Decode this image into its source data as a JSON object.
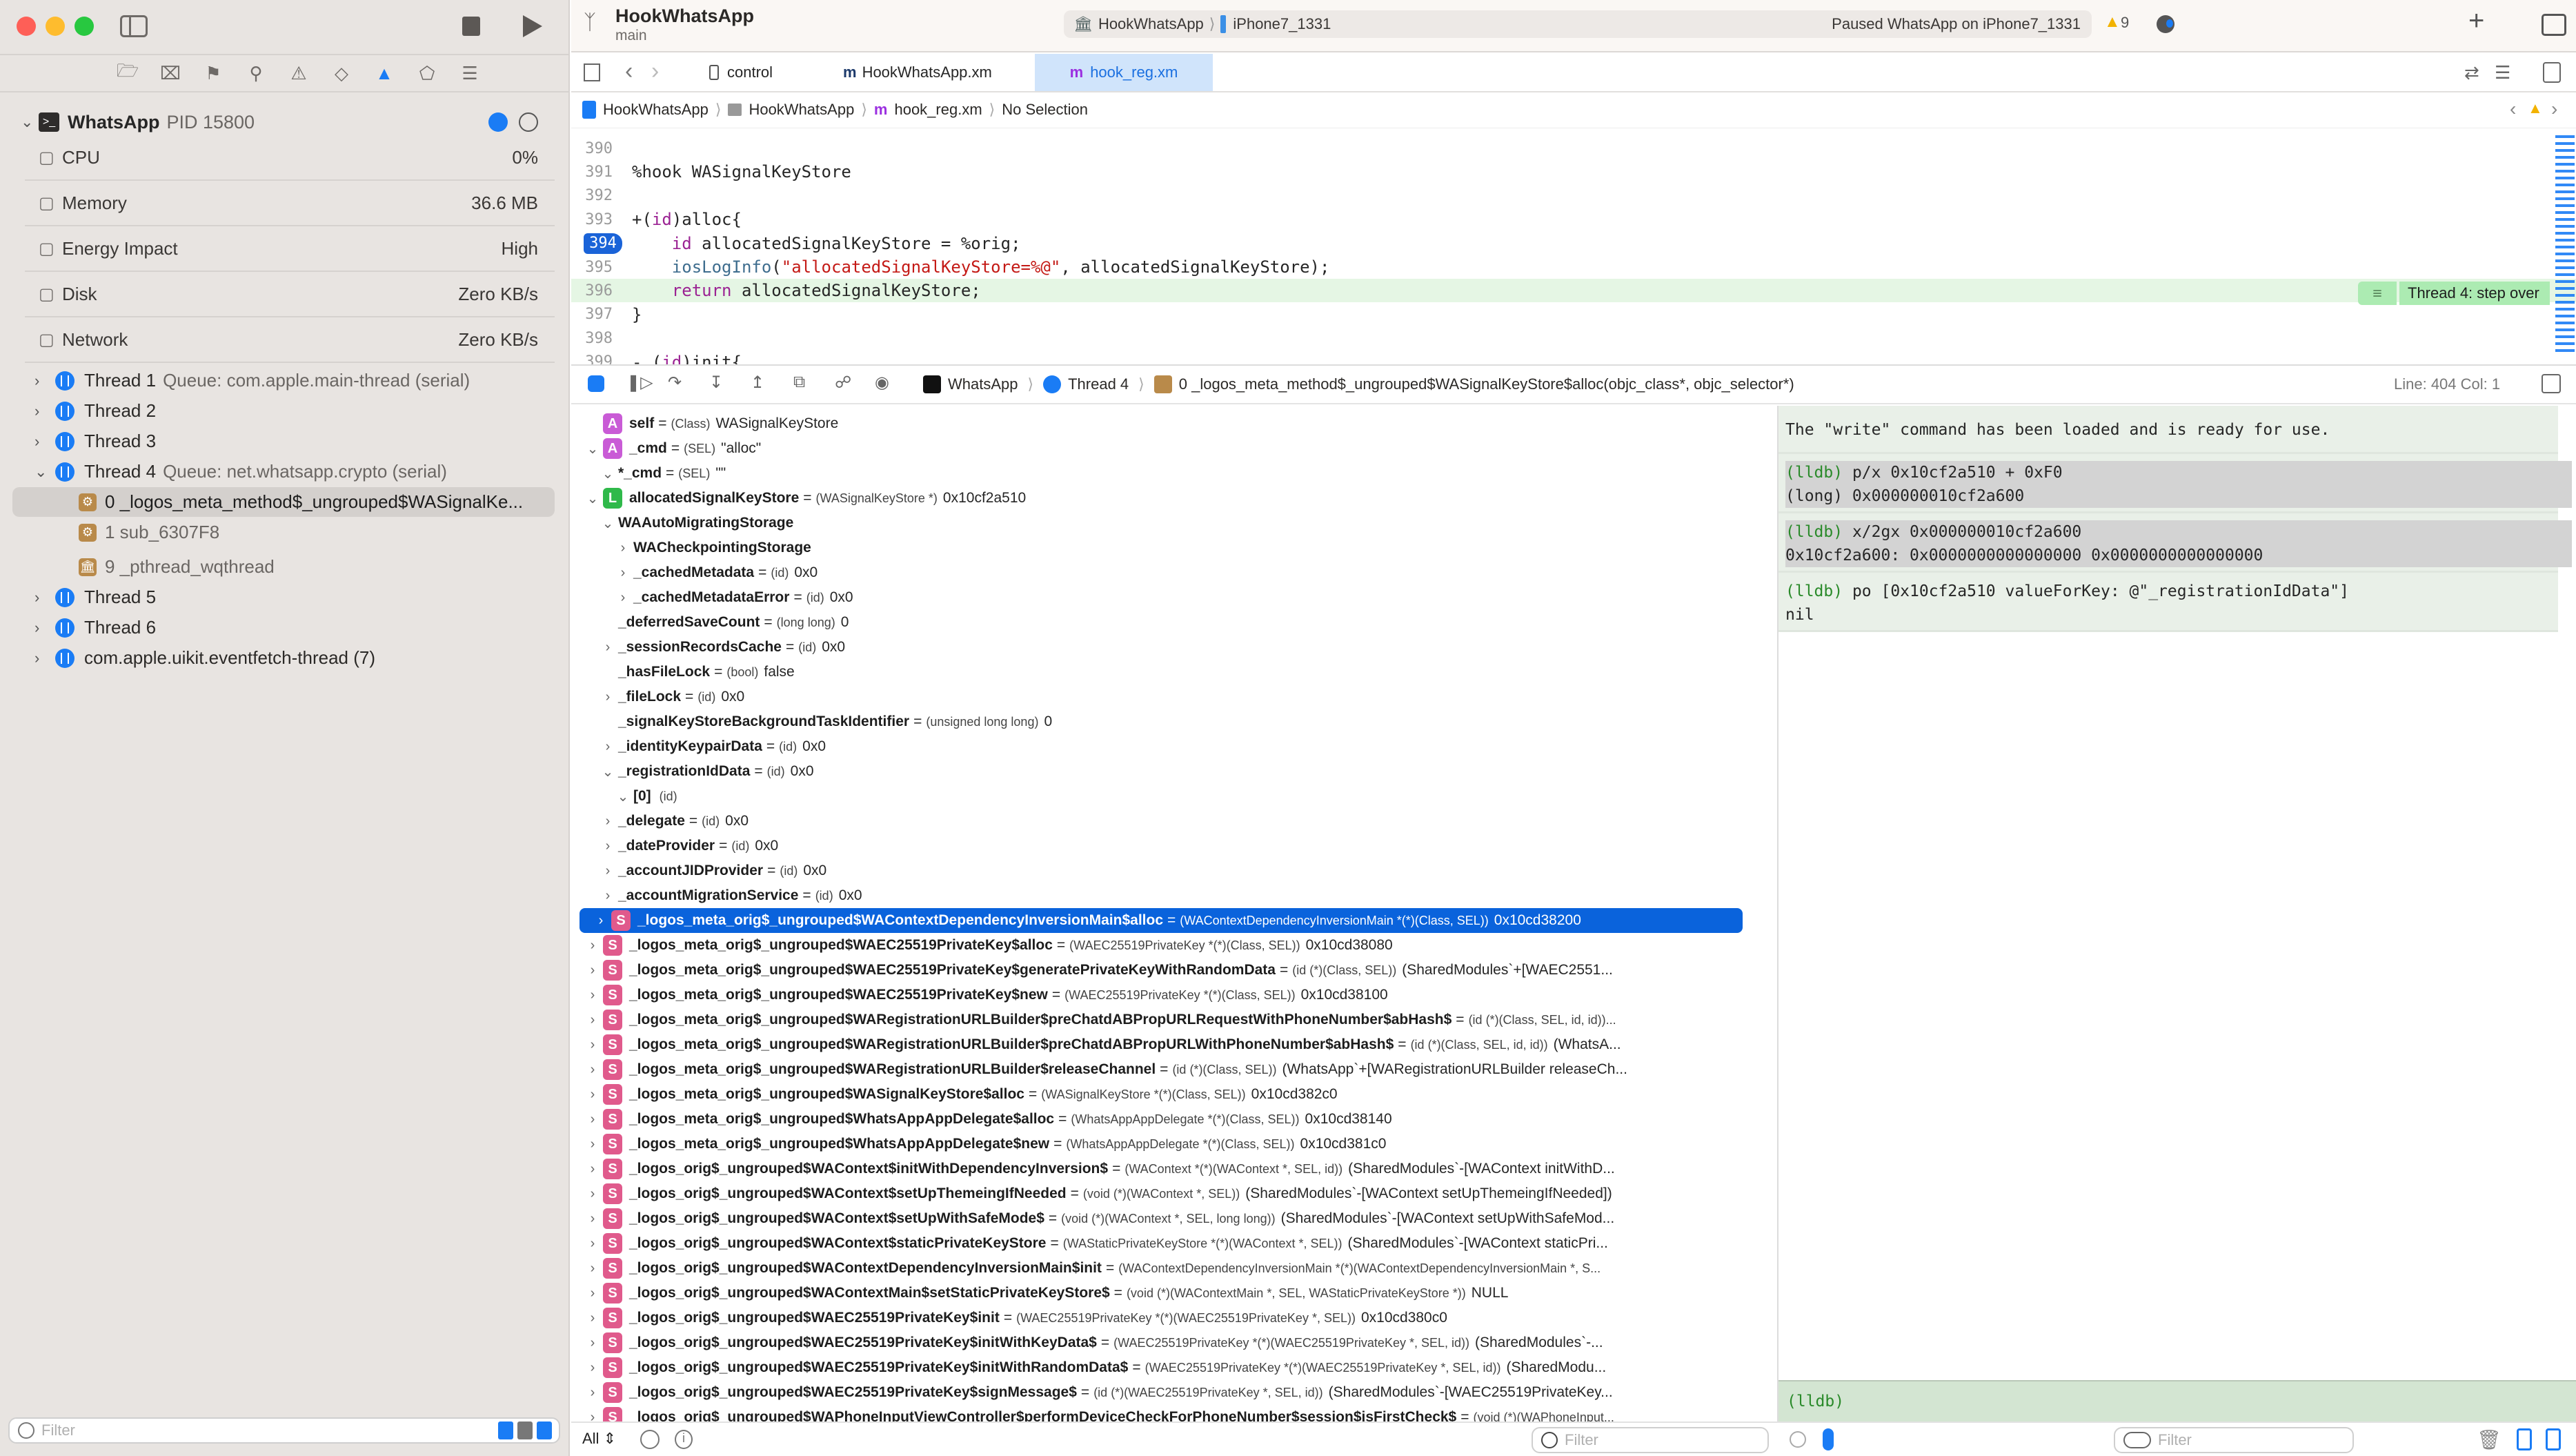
{
  "window": {
    "project": "HookWhatsApp",
    "branch": "main",
    "scheme": "HookWhatsApp",
    "device": "iPhone7_1331",
    "status": "Paused WhatsApp on iPhone7_1331",
    "warning_count": "9"
  },
  "navigator": {
    "process": {
      "name": "WhatsApp",
      "pid": "PID 15800"
    },
    "resources": [
      {
        "icon": "cpu-icon",
        "label": "CPU",
        "value": "0%"
      },
      {
        "icon": "memory-icon",
        "label": "Memory",
        "value": "36.6 MB"
      },
      {
        "icon": "energy-icon",
        "label": "Energy Impact",
        "value": "High"
      },
      {
        "icon": "disk-icon",
        "label": "Disk",
        "value": "Zero KB/s"
      },
      {
        "icon": "network-icon",
        "label": "Network",
        "value": "Zero KB/s"
      }
    ],
    "threads": [
      {
        "name": "Thread 1",
        "queue": "Queue: com.apple.main-thread (serial)",
        "expanded": false
      },
      {
        "name": "Thread 2",
        "queue": "",
        "expanded": false
      },
      {
        "name": "Thread 3",
        "queue": "",
        "expanded": false
      },
      {
        "name": "Thread 4",
        "queue": "Queue: net.whatsapp.crypto (serial)",
        "expanded": true
      },
      {
        "name": "Thread 5",
        "queue": "",
        "expanded": false
      },
      {
        "name": "Thread 6",
        "queue": "",
        "expanded": false
      },
      {
        "name": "com.apple.uikit.eventfetch-thread (7)",
        "queue": "",
        "expanded": false
      }
    ],
    "frames": [
      {
        "label": "0 _logos_meta_method$_ungrouped$WASignalKe...",
        "selected": true
      },
      {
        "label": "1 sub_6307F8",
        "selected": false
      },
      {
        "label": "9 _pthread_wqthread",
        "selected": false
      }
    ],
    "filter_placeholder": "Filter"
  },
  "tabs": [
    {
      "label": "control",
      "active": false
    },
    {
      "label": "HookWhatsApp.xm",
      "active": false
    },
    {
      "label": "hook_reg.xm",
      "active": true
    }
  ],
  "breadcrumb": [
    "HookWhatsApp",
    "HookWhatsApp",
    "hook_reg.xm",
    "No Selection"
  ],
  "code": {
    "lines": [
      {
        "n": "390",
        "text": ""
      },
      {
        "n": "391",
        "text": "%hook WASignalKeyStore"
      },
      {
        "n": "392",
        "text": ""
      },
      {
        "n": "393",
        "text": "+(id)alloc{"
      },
      {
        "n": "394",
        "text": "    id allocatedSignalKeyStore = %orig;"
      },
      {
        "n": "395",
        "text": "    iosLogInfo(\"allocatedSignalKeyStore=%@\", allocatedSignalKeyStore);"
      },
      {
        "n": "396",
        "text": "    return allocatedSignalKeyStore;"
      },
      {
        "n": "397",
        "text": "}"
      },
      {
        "n": "398",
        "text": ""
      },
      {
        "n": "399",
        "text": "- (id)init{"
      }
    ],
    "breakpoint_line": "394",
    "current_line": "396",
    "annotation": "Thread 4: step over"
  },
  "debugbar": {
    "process": "WhatsApp",
    "thread": "Thread 4",
    "frame": "0 _logos_meta_method$_ungrouped$WASignalKeyStore$alloc(objc_class*, objc_selector*)",
    "position": "Line: 404  Col: 1"
  },
  "variables": [
    {
      "indent": 0,
      "chev": "",
      "badge": "A",
      "name": "self",
      "type": "(Class)",
      "value": "WASignalKeyStore"
    },
    {
      "indent": 0,
      "chev": "v",
      "badge": "A",
      "name": "_cmd",
      "type": "(SEL)",
      "value": "\"alloc\""
    },
    {
      "indent": 1,
      "chev": "v",
      "badge": "",
      "name": "*_cmd",
      "type": "(SEL)",
      "value": "\"\""
    },
    {
      "indent": 0,
      "chev": "v",
      "badge": "L",
      "name": "allocatedSignalKeyStore",
      "type": "(WASignalKeyStore *)",
      "value": "0x10cf2a510"
    },
    {
      "indent": 1,
      "chev": "v",
      "badge": "",
      "name": "WAAutoMigratingStorage",
      "type": "",
      "value": ""
    },
    {
      "indent": 2,
      "chev": ">",
      "badge": "",
      "name": "WACheckpointingStorage",
      "type": "",
      "value": ""
    },
    {
      "indent": 2,
      "chev": ">",
      "badge": "",
      "name": "_cachedMetadata",
      "type": "(id)",
      "value": "0x0"
    },
    {
      "indent": 2,
      "chev": ">",
      "badge": "",
      "name": "_cachedMetadataError",
      "type": "(id)",
      "value": "0x0"
    },
    {
      "indent": 1,
      "chev": "",
      "badge": "",
      "name": "_deferredSaveCount",
      "type": "(long long)",
      "value": "0"
    },
    {
      "indent": 1,
      "chev": ">",
      "badge": "",
      "name": "_sessionRecordsCache",
      "type": "(id)",
      "value": "0x0"
    },
    {
      "indent": 1,
      "chev": "",
      "badge": "",
      "name": "_hasFileLock",
      "type": "(bool)",
      "value": "false"
    },
    {
      "indent": 1,
      "chev": ">",
      "badge": "",
      "name": "_fileLock",
      "type": "(id)",
      "value": "0x0"
    },
    {
      "indent": 1,
      "chev": "",
      "badge": "",
      "name": "_signalKeyStoreBackgroundTaskIdentifier",
      "type": "(unsigned long long)",
      "value": "0"
    },
    {
      "indent": 1,
      "chev": ">",
      "badge": "",
      "name": "_identityKeypairData",
      "type": "(id)",
      "value": "0x0"
    },
    {
      "indent": 1,
      "chev": "v",
      "badge": "",
      "name": "_registrationIdData",
      "type": "(id)",
      "value": "0x0"
    },
    {
      "indent": 2,
      "chev": "v",
      "badge": "",
      "name": "[0]",
      "type": "(id)",
      "value": ""
    },
    {
      "indent": 1,
      "chev": ">",
      "badge": "",
      "name": "_delegate",
      "type": "(id)",
      "value": "0x0"
    },
    {
      "indent": 1,
      "chev": ">",
      "badge": "",
      "name": "_dateProvider",
      "type": "(id)",
      "value": "0x0"
    },
    {
      "indent": 1,
      "chev": ">",
      "badge": "",
      "name": "_accountJIDProvider",
      "type": "(id)",
      "value": "0x0"
    },
    {
      "indent": 1,
      "chev": ">",
      "badge": "",
      "name": "_accountMigrationService",
      "type": "(id)",
      "value": "0x0"
    },
    {
      "indent": 0,
      "chev": ">",
      "badge": "S",
      "selected": true,
      "name": "_logos_meta_orig$_ungrouped$WAContextDependencyInversionMain$alloc",
      "type": "(WAContextDependencyInversionMain *(*)(Class, SEL))",
      "value": "0x10cd38200"
    },
    {
      "indent": 0,
      "chev": ">",
      "badge": "S",
      "name": "_logos_meta_orig$_ungrouped$WAEC25519PrivateKey$alloc",
      "type": "(WAEC25519PrivateKey *(*)(Class, SEL))",
      "value": "0x10cd38080"
    },
    {
      "indent": 0,
      "chev": ">",
      "badge": "S",
      "name": "_logos_meta_orig$_ungrouped$WAEC25519PrivateKey$generatePrivateKeyWithRandomData",
      "type": "(id (*)(Class, SEL))",
      "value": "(SharedModules`+[WAEC2551..."
    },
    {
      "indent": 0,
      "chev": ">",
      "badge": "S",
      "name": "_logos_meta_orig$_ungrouped$WAEC25519PrivateKey$new",
      "type": "(WAEC25519PrivateKey *(*)(Class, SEL))",
      "value": "0x10cd38100"
    },
    {
      "indent": 0,
      "chev": ">",
      "badge": "S",
      "name": "_logos_meta_orig$_ungrouped$WARegistrationURLBuilder$preChatdABPropURLRequestWithPhoneNumber$abHash$",
      "type": "(id (*)(Class, SEL, id, id))...",
      "value": ""
    },
    {
      "indent": 0,
      "chev": ">",
      "badge": "S",
      "name": "_logos_meta_orig$_ungrouped$WARegistrationURLBuilder$preChatdABPropURLWithPhoneNumber$abHash$",
      "type": "(id (*)(Class, SEL, id, id))",
      "value": "(WhatsA..."
    },
    {
      "indent": 0,
      "chev": ">",
      "badge": "S",
      "name": "_logos_meta_orig$_ungrouped$WARegistrationURLBuilder$releaseChannel",
      "type": "(id (*)(Class, SEL))",
      "value": "(WhatsApp`+[WARegistrationURLBuilder releaseCh..."
    },
    {
      "indent": 0,
      "chev": ">",
      "badge": "S",
      "name": "_logos_meta_orig$_ungrouped$WASignalKeyStore$alloc",
      "type": "(WASignalKeyStore *(*)(Class, SEL))",
      "value": "0x10cd382c0"
    },
    {
      "indent": 0,
      "chev": ">",
      "badge": "S",
      "name": "_logos_meta_orig$_ungrouped$WhatsAppAppDelegate$alloc",
      "type": "(WhatsAppAppDelegate *(*)(Class, SEL))",
      "value": "0x10cd38140"
    },
    {
      "indent": 0,
      "chev": ">",
      "badge": "S",
      "name": "_logos_meta_orig$_ungrouped$WhatsAppAppDelegate$new",
      "type": "(WhatsAppAppDelegate *(*)(Class, SEL))",
      "value": "0x10cd381c0"
    },
    {
      "indent": 0,
      "chev": ">",
      "badge": "S",
      "name": "_logos_orig$_ungrouped$WAContext$initWithDependencyInversion$",
      "type": "(WAContext *(*)(WAContext *, SEL, id))",
      "value": "(SharedModules`-[WAContext initWithD..."
    },
    {
      "indent": 0,
      "chev": ">",
      "badge": "S",
      "name": "_logos_orig$_ungrouped$WAContext$setUpThemeingIfNeeded",
      "type": "(void (*)(WAContext *, SEL))",
      "value": "(SharedModules`-[WAContext setUpThemeingIfNeeded])"
    },
    {
      "indent": 0,
      "chev": ">",
      "badge": "S",
      "name": "_logos_orig$_ungrouped$WAContext$setUpWithSafeMode$",
      "type": "(void (*)(WAContext *, SEL, long long))",
      "value": "(SharedModules`-[WAContext setUpWithSafeMod..."
    },
    {
      "indent": 0,
      "chev": ">",
      "badge": "S",
      "name": "_logos_orig$_ungrouped$WAContext$staticPrivateKeyStore",
      "type": "(WAStaticPrivateKeyStore *(*)(WAContext *, SEL))",
      "value": "(SharedModules`-[WAContext staticPri..."
    },
    {
      "indent": 0,
      "chev": ">",
      "badge": "S",
      "name": "_logos_orig$_ungrouped$WAContextDependencyInversionMain$init",
      "type": "(WAContextDependencyInversionMain *(*)(WAContextDependencyInversionMain *, S...",
      "value": ""
    },
    {
      "indent": 0,
      "chev": ">",
      "badge": "S",
      "name": "_logos_orig$_ungrouped$WAContextMain$setStaticPrivateKeyStore$",
      "type": "(void (*)(WAContextMain *, SEL, WAStaticPrivateKeyStore *))",
      "value": "NULL"
    },
    {
      "indent": 0,
      "chev": ">",
      "badge": "S",
      "name": "_logos_orig$_ungrouped$WAEC25519PrivateKey$init",
      "type": "(WAEC25519PrivateKey *(*)(WAEC25519PrivateKey *, SEL))",
      "value": "0x10cd380c0"
    },
    {
      "indent": 0,
      "chev": ">",
      "badge": "S",
      "name": "_logos_orig$_ungrouped$WAEC25519PrivateKey$initWithKeyData$",
      "type": "(WAEC25519PrivateKey *(*)(WAEC25519PrivateKey *, SEL, id))",
      "value": "(SharedModules`-..."
    },
    {
      "indent": 0,
      "chev": ">",
      "badge": "S",
      "name": "_logos_orig$_ungrouped$WAEC25519PrivateKey$initWithRandomData$",
      "type": "(WAEC25519PrivateKey *(*)(WAEC25519PrivateKey *, SEL, id))",
      "value": "(SharedModu..."
    },
    {
      "indent": 0,
      "chev": ">",
      "badge": "S",
      "name": "_logos_orig$_ungrouped$WAEC25519PrivateKey$signMessage$",
      "type": "(id (*)(WAEC25519PrivateKey *, SEL, id))",
      "value": "(SharedModules`-[WAEC25519PrivateKey..."
    },
    {
      "indent": 0,
      "chev": ">",
      "badge": "S",
      "name": "_logos_orig$_ungrouped$WAPhoneInputViewController$performDeviceCheckForPhoneNumber$session$isFirstCheck$",
      "type": "(void (*)(WAPhoneInput...",
      "value": ""
    }
  ],
  "variables_footer": {
    "scope": "All",
    "filter_placeholder": "Filter"
  },
  "console": {
    "blocks": [
      {
        "lines": [
          {
            "prompt": "",
            "text": "The \"write\" command has been loaded and is ready for use."
          }
        ],
        "highlight": false
      },
      {
        "lines": [
          {
            "prompt": "(lldb)",
            "text": " p/x 0x10cf2a510 + 0xF0"
          },
          {
            "prompt": "",
            "text": "(long) 0x000000010cf2a600"
          }
        ],
        "highlight": true
      },
      {
        "lines": [
          {
            "prompt": "(lldb)",
            "text": " x/2gx 0x000000010cf2a600"
          },
          {
            "prompt": "",
            "text": "0x10cf2a600: 0x0000000000000000 0x0000000000000000"
          }
        ],
        "highlight": true
      },
      {
        "lines": [
          {
            "prompt": "(lldb)",
            "text": " po [0x10cf2a510 valueForKey: @\"_registrationIdData\"]"
          },
          {
            "prompt": "",
            "text": "nil"
          }
        ],
        "highlight": false
      }
    ],
    "prompt": "(lldb)",
    "filter_placeholder": "Filter"
  },
  "colors": {
    "accent": "#0a63dc",
    "thread_badge": "#1a7cf5",
    "static_badge": "#e05a8c",
    "arg_badge": "#c95bd6",
    "local_badge": "#2fb94a",
    "frame_badge": "#b98a4a",
    "current_line_bg": "#e5f6e4",
    "annotation_bg": "#acebb2",
    "console_bg": "#e9f0e8",
    "lldb_prompt": "#2a8a2a"
  }
}
